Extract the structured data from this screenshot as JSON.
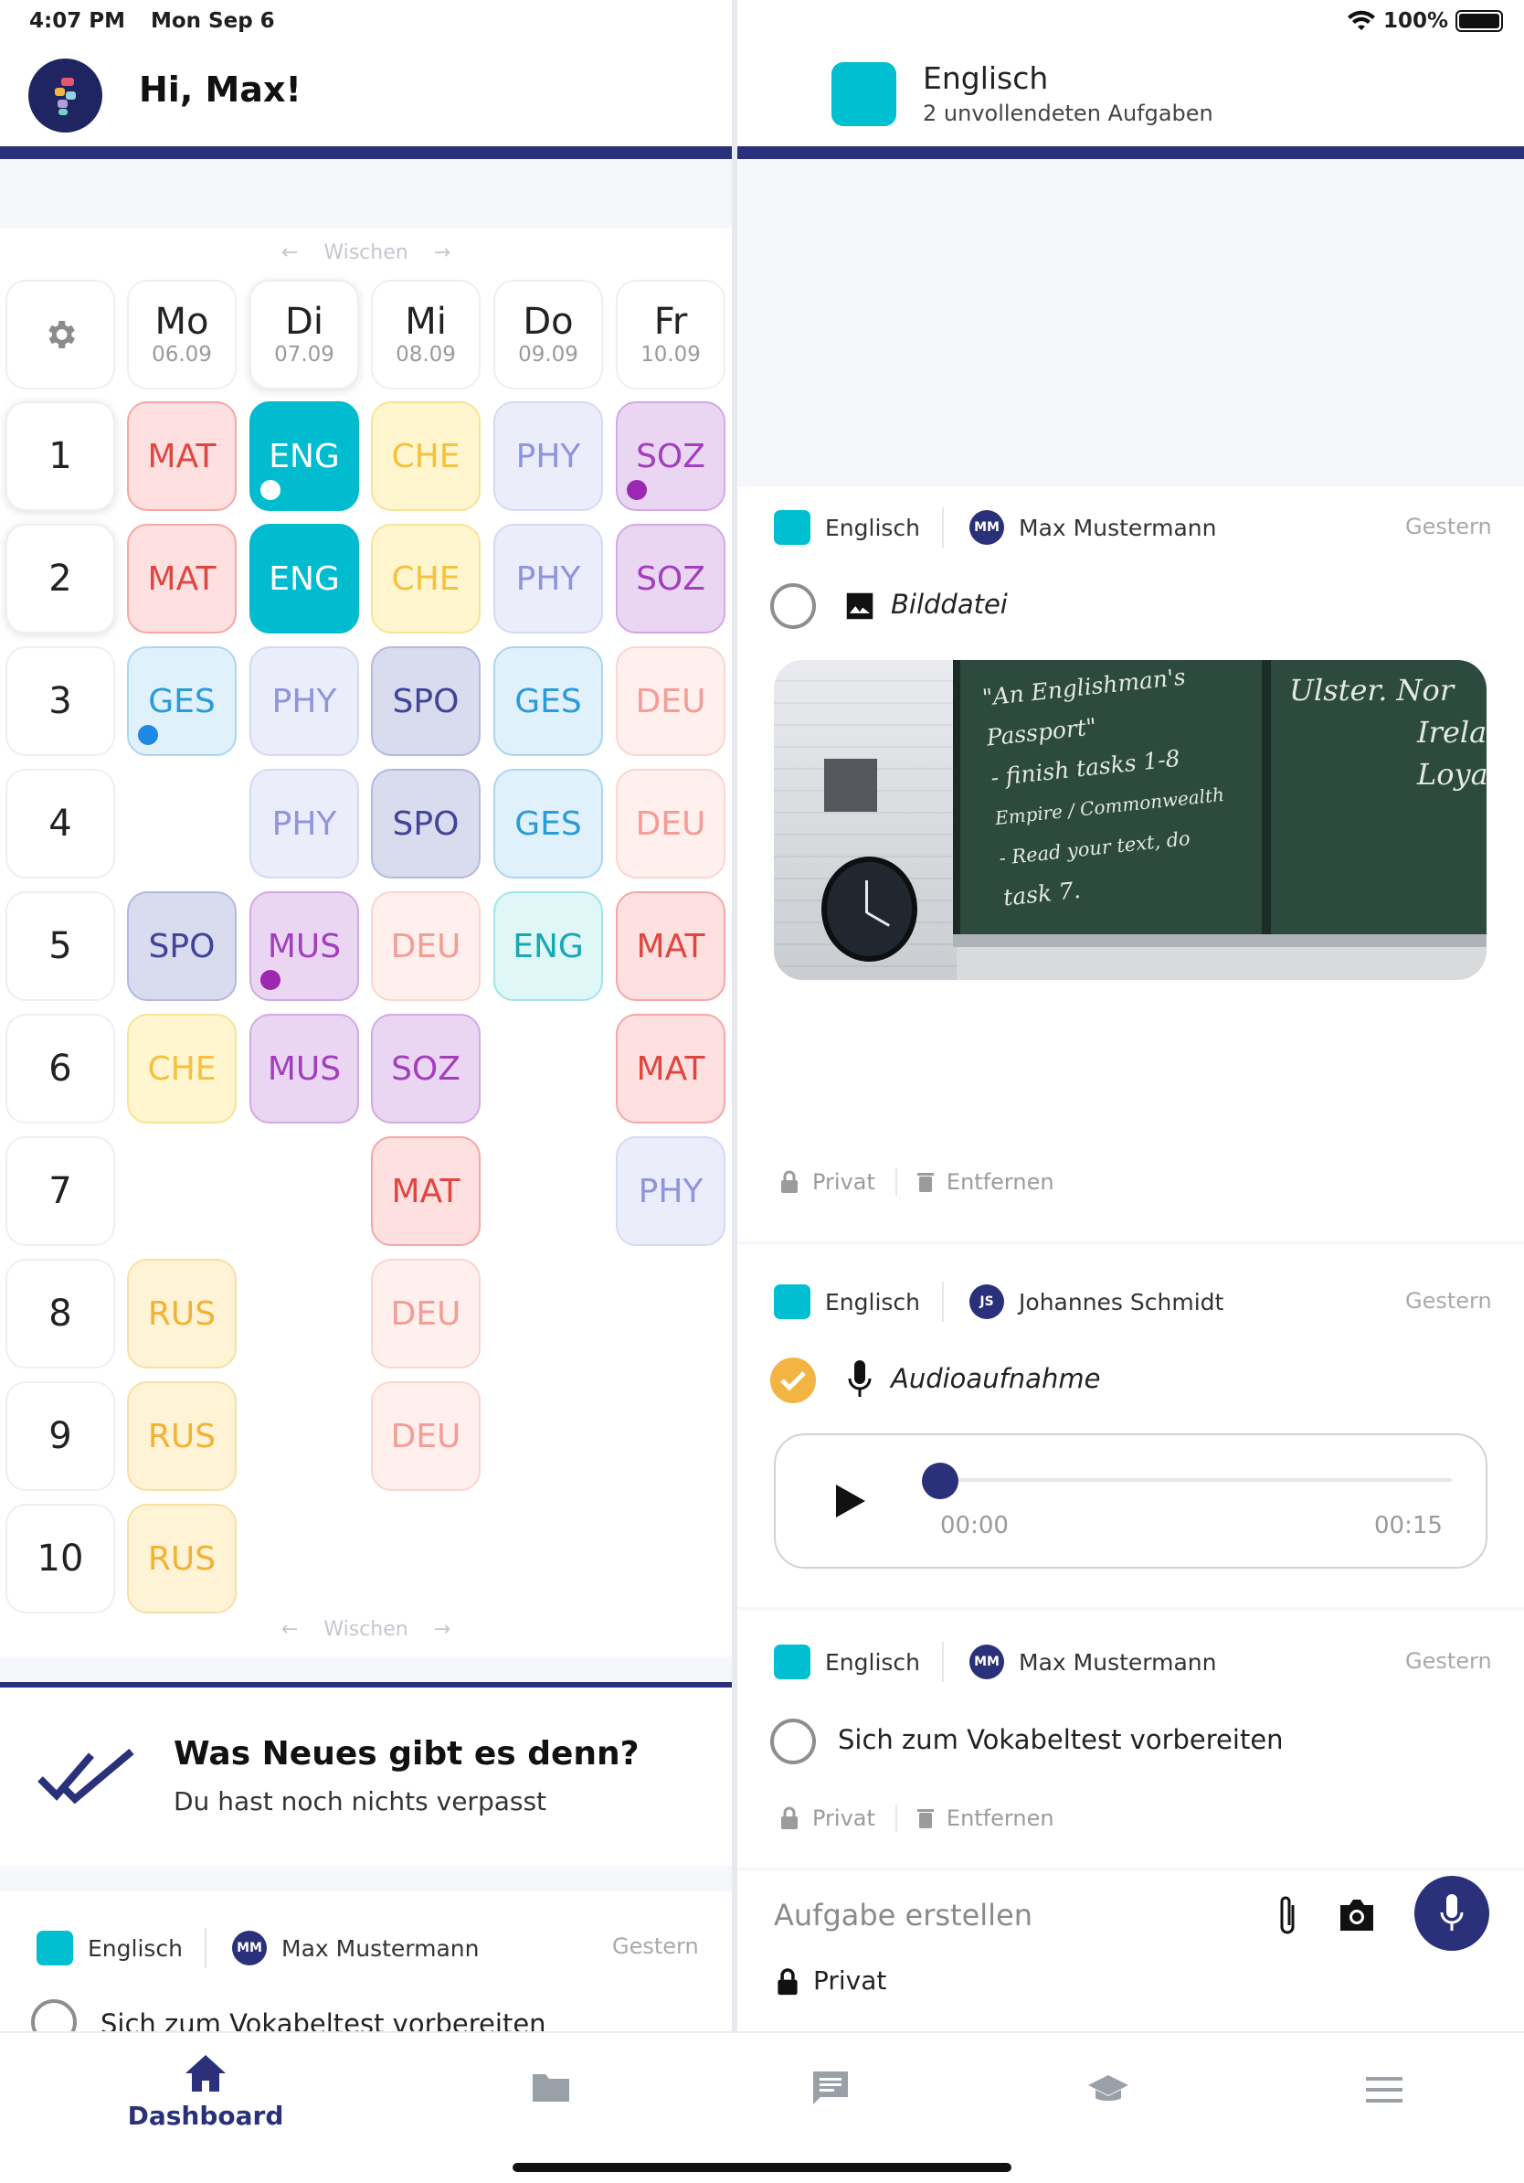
{
  "status": {
    "time": "4:07 PM",
    "date": "Mon Sep 6",
    "battery": "100%"
  },
  "left": {
    "greeting": "Hi, Max!",
    "swipe_label": "Wischen",
    "days": [
      {
        "name": "Mo",
        "date": "06.09"
      },
      {
        "name": "Di",
        "date": "07.09"
      },
      {
        "name": "Mi",
        "date": "08.09"
      },
      {
        "name": "Do",
        "date": "09.09"
      },
      {
        "name": "Fr",
        "date": "10.09"
      }
    ],
    "periods": [
      "1",
      "2",
      "3",
      "4",
      "5",
      "6",
      "7",
      "8",
      "9",
      "10"
    ],
    "subjects": {
      "MAT": "MAT",
      "ENG": "ENG",
      "CHE": "CHE",
      "PHY": "PHY",
      "SOZ": "SOZ",
      "GES": "GES",
      "SPO": "SPO",
      "DEU": "DEU",
      "MUS": "MUS",
      "RUS": "RUS"
    },
    "news": {
      "title": "Was Neues gibt es denn?",
      "subtitle": "Du hast noch nichts verpasst"
    },
    "preview_card": {
      "subject": "Englisch",
      "initials": "MM",
      "author": "Max Mustermann",
      "when": "Gestern",
      "title": "Sich zum Vokabeltest vorbereiten"
    }
  },
  "right": {
    "header": {
      "subject": "Englisch",
      "subtitle": "2 unvollendeten Aufgaben"
    },
    "cards": [
      {
        "subject": "Englisch",
        "initials": "MM",
        "author": "Max Mustermann",
        "when": "Gestern",
        "title": "Bilddatei",
        "private_label": "Privat",
        "remove_label": "Entfernen",
        "done": false
      },
      {
        "subject": "Englisch",
        "initials": "JS",
        "author": "Johannes Schmidt",
        "when": "Gestern",
        "title": "Audioaufnahme",
        "done": true,
        "audio": {
          "current": "00:00",
          "total": "00:15",
          "progress": 0
        }
      },
      {
        "subject": "Englisch",
        "initials": "MM",
        "author": "Max Mustermann",
        "when": "Gestern",
        "title": "Sich zum Vokabeltest vorbereiten",
        "private_label": "Privat",
        "remove_label": "Entfernen",
        "done": false
      }
    ],
    "composer": {
      "placeholder": "Aufgabe erstellen",
      "privacy": "Privat"
    },
    "blackboard_lines": [
      "\"An Englishman's",
      "Passport\"",
      "- finish tasks 1-8",
      "Empire / Commonwealth",
      "- Read your text, do",
      "task 7.",
      "Ulster. Nor",
      "Irela",
      "Loya"
    ]
  },
  "nav": {
    "items": [
      {
        "label": "Dashboard",
        "icon": "home-icon"
      },
      {
        "label": "",
        "icon": "folder-icon"
      },
      {
        "label": "",
        "icon": "chat-icon"
      },
      {
        "label": "",
        "icon": "graduation-cap-icon"
      },
      {
        "label": "",
        "icon": "menu-icon"
      }
    ]
  },
  "colors": {
    "navy": "#2a3079",
    "teal": "#00bfd1",
    "check": "#f2b544"
  }
}
